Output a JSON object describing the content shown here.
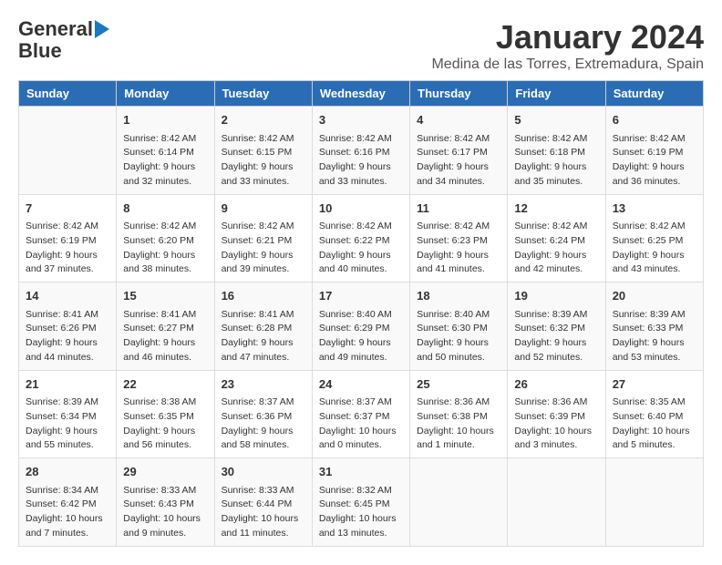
{
  "header": {
    "logo_line1": "General",
    "logo_line2": "Blue",
    "main_title": "January 2024",
    "subtitle": "Medina de las Torres, Extremadura, Spain"
  },
  "calendar": {
    "columns": [
      "Sunday",
      "Monday",
      "Tuesday",
      "Wednesday",
      "Thursday",
      "Friday",
      "Saturday"
    ],
    "weeks": [
      [
        {
          "day": "",
          "info": ""
        },
        {
          "day": "1",
          "info": "Sunrise: 8:42 AM\nSunset: 6:14 PM\nDaylight: 9 hours\nand 32 minutes."
        },
        {
          "day": "2",
          "info": "Sunrise: 8:42 AM\nSunset: 6:15 PM\nDaylight: 9 hours\nand 33 minutes."
        },
        {
          "day": "3",
          "info": "Sunrise: 8:42 AM\nSunset: 6:16 PM\nDaylight: 9 hours\nand 33 minutes."
        },
        {
          "day": "4",
          "info": "Sunrise: 8:42 AM\nSunset: 6:17 PM\nDaylight: 9 hours\nand 34 minutes."
        },
        {
          "day": "5",
          "info": "Sunrise: 8:42 AM\nSunset: 6:18 PM\nDaylight: 9 hours\nand 35 minutes."
        },
        {
          "day": "6",
          "info": "Sunrise: 8:42 AM\nSunset: 6:19 PM\nDaylight: 9 hours\nand 36 minutes."
        }
      ],
      [
        {
          "day": "7",
          "info": "Sunrise: 8:42 AM\nSunset: 6:19 PM\nDaylight: 9 hours\nand 37 minutes."
        },
        {
          "day": "8",
          "info": "Sunrise: 8:42 AM\nSunset: 6:20 PM\nDaylight: 9 hours\nand 38 minutes."
        },
        {
          "day": "9",
          "info": "Sunrise: 8:42 AM\nSunset: 6:21 PM\nDaylight: 9 hours\nand 39 minutes."
        },
        {
          "day": "10",
          "info": "Sunrise: 8:42 AM\nSunset: 6:22 PM\nDaylight: 9 hours\nand 40 minutes."
        },
        {
          "day": "11",
          "info": "Sunrise: 8:42 AM\nSunset: 6:23 PM\nDaylight: 9 hours\nand 41 minutes."
        },
        {
          "day": "12",
          "info": "Sunrise: 8:42 AM\nSunset: 6:24 PM\nDaylight: 9 hours\nand 42 minutes."
        },
        {
          "day": "13",
          "info": "Sunrise: 8:42 AM\nSunset: 6:25 PM\nDaylight: 9 hours\nand 43 minutes."
        }
      ],
      [
        {
          "day": "14",
          "info": "Sunrise: 8:41 AM\nSunset: 6:26 PM\nDaylight: 9 hours\nand 44 minutes."
        },
        {
          "day": "15",
          "info": "Sunrise: 8:41 AM\nSunset: 6:27 PM\nDaylight: 9 hours\nand 46 minutes."
        },
        {
          "day": "16",
          "info": "Sunrise: 8:41 AM\nSunset: 6:28 PM\nDaylight: 9 hours\nand 47 minutes."
        },
        {
          "day": "17",
          "info": "Sunrise: 8:40 AM\nSunset: 6:29 PM\nDaylight: 9 hours\nand 49 minutes."
        },
        {
          "day": "18",
          "info": "Sunrise: 8:40 AM\nSunset: 6:30 PM\nDaylight: 9 hours\nand 50 minutes."
        },
        {
          "day": "19",
          "info": "Sunrise: 8:39 AM\nSunset: 6:32 PM\nDaylight: 9 hours\nand 52 minutes."
        },
        {
          "day": "20",
          "info": "Sunrise: 8:39 AM\nSunset: 6:33 PM\nDaylight: 9 hours\nand 53 minutes."
        }
      ],
      [
        {
          "day": "21",
          "info": "Sunrise: 8:39 AM\nSunset: 6:34 PM\nDaylight: 9 hours\nand 55 minutes."
        },
        {
          "day": "22",
          "info": "Sunrise: 8:38 AM\nSunset: 6:35 PM\nDaylight: 9 hours\nand 56 minutes."
        },
        {
          "day": "23",
          "info": "Sunrise: 8:37 AM\nSunset: 6:36 PM\nDaylight: 9 hours\nand 58 minutes."
        },
        {
          "day": "24",
          "info": "Sunrise: 8:37 AM\nSunset: 6:37 PM\nDaylight: 10 hours\nand 0 minutes."
        },
        {
          "day": "25",
          "info": "Sunrise: 8:36 AM\nSunset: 6:38 PM\nDaylight: 10 hours\nand 1 minute."
        },
        {
          "day": "26",
          "info": "Sunrise: 8:36 AM\nSunset: 6:39 PM\nDaylight: 10 hours\nand 3 minutes."
        },
        {
          "day": "27",
          "info": "Sunrise: 8:35 AM\nSunset: 6:40 PM\nDaylight: 10 hours\nand 5 minutes."
        }
      ],
      [
        {
          "day": "28",
          "info": "Sunrise: 8:34 AM\nSunset: 6:42 PM\nDaylight: 10 hours\nand 7 minutes."
        },
        {
          "day": "29",
          "info": "Sunrise: 8:33 AM\nSunset: 6:43 PM\nDaylight: 10 hours\nand 9 minutes."
        },
        {
          "day": "30",
          "info": "Sunrise: 8:33 AM\nSunset: 6:44 PM\nDaylight: 10 hours\nand 11 minutes."
        },
        {
          "day": "31",
          "info": "Sunrise: 8:32 AM\nSunset: 6:45 PM\nDaylight: 10 hours\nand 13 minutes."
        },
        {
          "day": "",
          "info": ""
        },
        {
          "day": "",
          "info": ""
        },
        {
          "day": "",
          "info": ""
        }
      ]
    ]
  }
}
